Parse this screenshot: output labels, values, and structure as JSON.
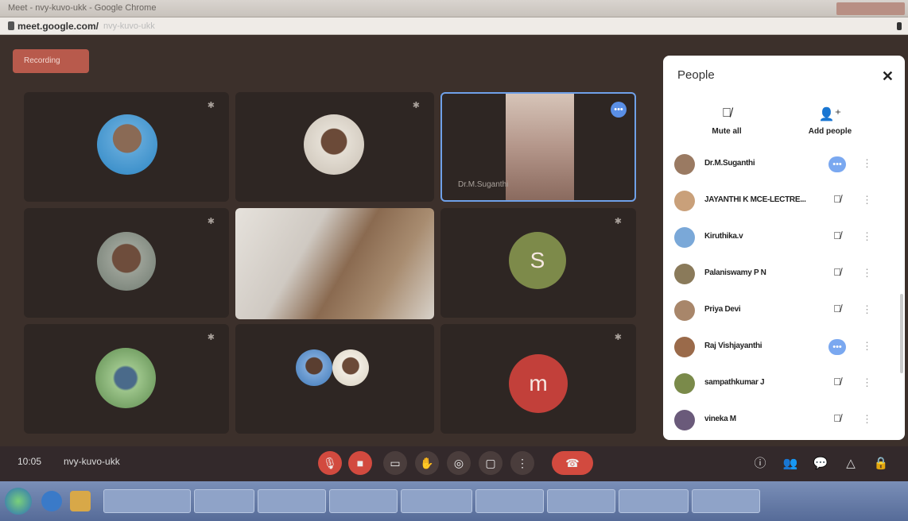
{
  "browser": {
    "title": "Meet - nvy-kuvo-ukk - Google Chrome",
    "host": "meet.google.com/",
    "path": "nvy-kuvo-ukk"
  },
  "recording": {
    "label": "Recording"
  },
  "tiles": [
    {
      "name": "",
      "kind": "avatar"
    },
    {
      "name": "",
      "kind": "avatar"
    },
    {
      "name": "Dr.M.Suganthi",
      "kind": "video"
    },
    {
      "name": "",
      "kind": "avatar"
    },
    {
      "name": "",
      "kind": "video"
    },
    {
      "name": "",
      "kind": "letter",
      "letter": "S"
    },
    {
      "name": "",
      "kind": "avatar"
    },
    {
      "name": "",
      "kind": "double"
    },
    {
      "name": "",
      "kind": "letter",
      "letter": "m"
    }
  ],
  "controls": {
    "time": "10:05",
    "meeting_code": "nvy-kuvo-ukk"
  },
  "panel": {
    "title": "People",
    "mute_all": "Mute all",
    "add_people": "Add people",
    "participants": [
      {
        "name": "Dr.M.Suganthi",
        "status": "speaking"
      },
      {
        "name": "JAYANTHI K MCE-LECTRE...",
        "status": "muted"
      },
      {
        "name": "Kiruthika.v",
        "status": "muted"
      },
      {
        "name": "Palaniswamy P N",
        "status": "muted"
      },
      {
        "name": "Priya Devi",
        "status": "muted"
      },
      {
        "name": "Raj Vishjayanthi",
        "status": "speaking"
      },
      {
        "name": "sampathkumar J",
        "status": "muted"
      },
      {
        "name": "vineka M",
        "status": "muted"
      }
    ]
  },
  "colors": {
    "accent_red": "#d24a3f",
    "speaking_blue": "#7aa8f0",
    "stage": "#3c302b"
  },
  "taskbar": {
    "tasks": [
      "",
      "",
      "",
      "",
      "",
      "",
      "",
      "",
      ""
    ]
  }
}
